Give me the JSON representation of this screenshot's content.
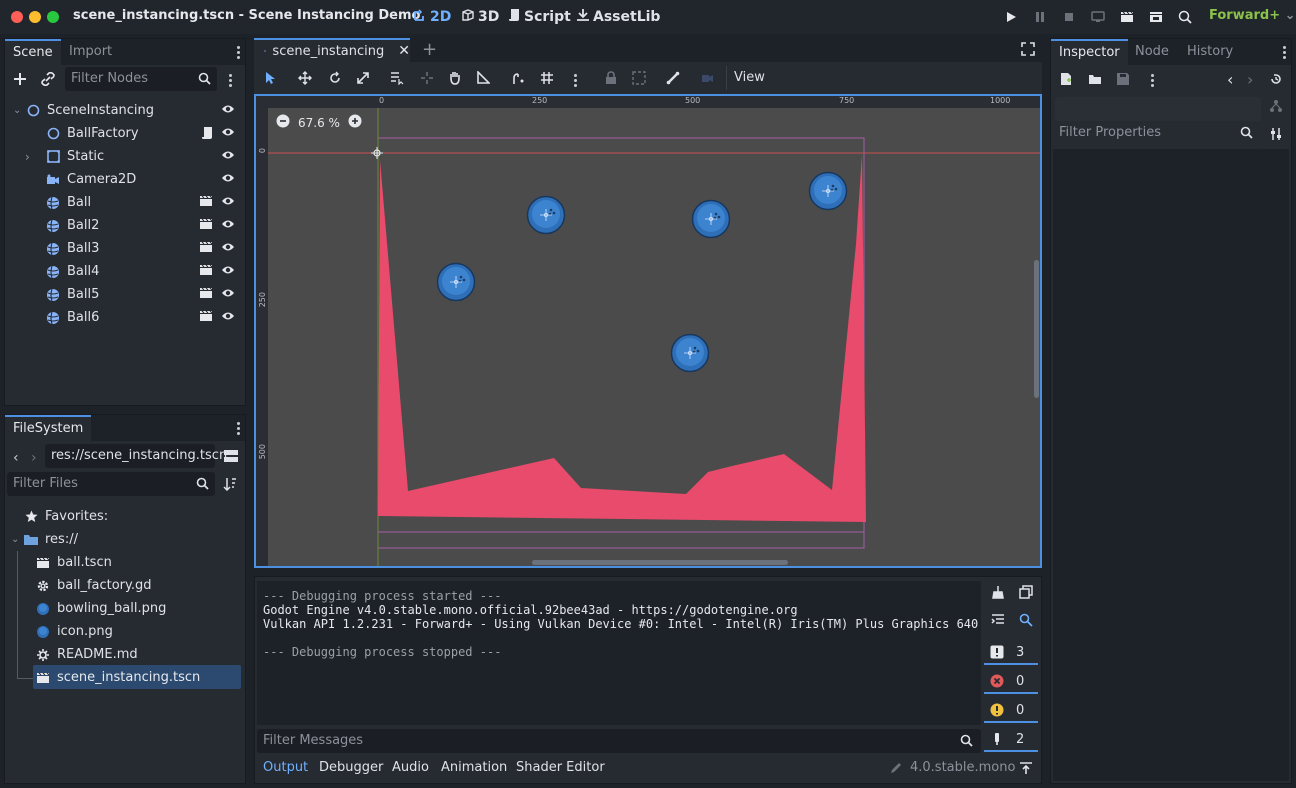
{
  "window": {
    "title": "scene_instancing.tscn - Scene Instancing Demo",
    "main_tabs": [
      {
        "label": "2D",
        "icon": "2d-icon",
        "active": true
      },
      {
        "label": "3D",
        "icon": "3d-icon",
        "active": false
      },
      {
        "label": "Script",
        "icon": "script-icon",
        "active": false
      },
      {
        "label": "AssetLib",
        "icon": "assetlib-icon",
        "active": false
      }
    ],
    "renderer": "Forward+"
  },
  "scene_dock": {
    "tabs": [
      "Scene",
      "Import"
    ],
    "filter_placeholder": "Filter Nodes",
    "nodes": [
      {
        "label": "SceneInstancing",
        "icon": "node2d-icon",
        "level": 0
      },
      {
        "label": "BallFactory",
        "icon": "node2d-icon",
        "level": 1
      },
      {
        "label": "Static",
        "icon": "staticbody-icon",
        "level": 1
      },
      {
        "label": "Camera2D",
        "icon": "camera-icon",
        "level": 1
      },
      {
        "label": "Ball",
        "icon": "rigidbody-icon",
        "level": 1
      },
      {
        "label": "Ball2",
        "icon": "rigidbody-icon",
        "level": 1
      },
      {
        "label": "Ball3",
        "icon": "rigidbody-icon",
        "level": 1
      },
      {
        "label": "Ball4",
        "icon": "rigidbody-icon",
        "level": 1
      },
      {
        "label": "Ball5",
        "icon": "rigidbody-icon",
        "level": 1
      },
      {
        "label": "Ball6",
        "icon": "rigidbody-icon",
        "level": 1
      }
    ]
  },
  "filesystem_dock": {
    "tab": "FileSystem",
    "path": "res://scene_instancing.tscn",
    "filter_placeholder": "Filter Files",
    "favorites_label": "Favorites:",
    "root_label": "res://",
    "files": [
      {
        "label": "ball.tscn",
        "icon": "scene-file-icon"
      },
      {
        "label": "ball_factory.gd",
        "icon": "gdscript-file-icon"
      },
      {
        "label": "bowling_ball.png",
        "icon": "image-file-icon"
      },
      {
        "label": "icon.png",
        "icon": "image-file-icon"
      },
      {
        "label": "README.md",
        "icon": "text-file-icon"
      },
      {
        "label": "scene_instancing.tscn",
        "icon": "scene-file-icon",
        "selected": true
      }
    ]
  },
  "editor": {
    "scene_tab": "scene_instancing",
    "zoom": "67.6 %",
    "view_menu": "View",
    "ruler_h_labels": [
      "0",
      "250",
      "500",
      "750",
      "1000"
    ],
    "ruler_v_labels": [
      "0",
      "250",
      "500"
    ]
  },
  "output": {
    "lines": [
      {
        "text": "--- Debugging process started ---",
        "kind": "muted"
      },
      {
        "text": "Godot Engine v4.0.stable.mono.official.92bee43ad - https://godotengine.org",
        "kind": "normal"
      },
      {
        "text": "Vulkan API 1.2.231 - Forward+ - Using Vulkan Device #0: Intel - Intel(R) Iris(TM) Plus Graphics 640",
        "kind": "normal"
      },
      {
        "text": "",
        "kind": "muted"
      },
      {
        "text": "--- Debugging process stopped ---",
        "kind": "muted"
      }
    ],
    "counters": [
      {
        "icon": "message-icon",
        "count": "3"
      },
      {
        "icon": "error-icon",
        "count": "0"
      },
      {
        "icon": "warning-icon",
        "count": "0"
      },
      {
        "icon": "editor-message-icon",
        "count": "2"
      }
    ],
    "filter_placeholder": "Filter Messages",
    "bottom_tabs": [
      "Output",
      "Debugger",
      "Audio",
      "Animation",
      "Shader Editor"
    ],
    "version": "4.0.stable.mono"
  },
  "inspector_dock": {
    "tabs": [
      "Inspector",
      "Node",
      "History"
    ],
    "filter_placeholder": "Filter Properties"
  },
  "colors": {
    "accent": "#4d8fe0",
    "static_body": "#e84b6b",
    "ball": "#2f6fb8",
    "renderer": "#8bc34a"
  }
}
